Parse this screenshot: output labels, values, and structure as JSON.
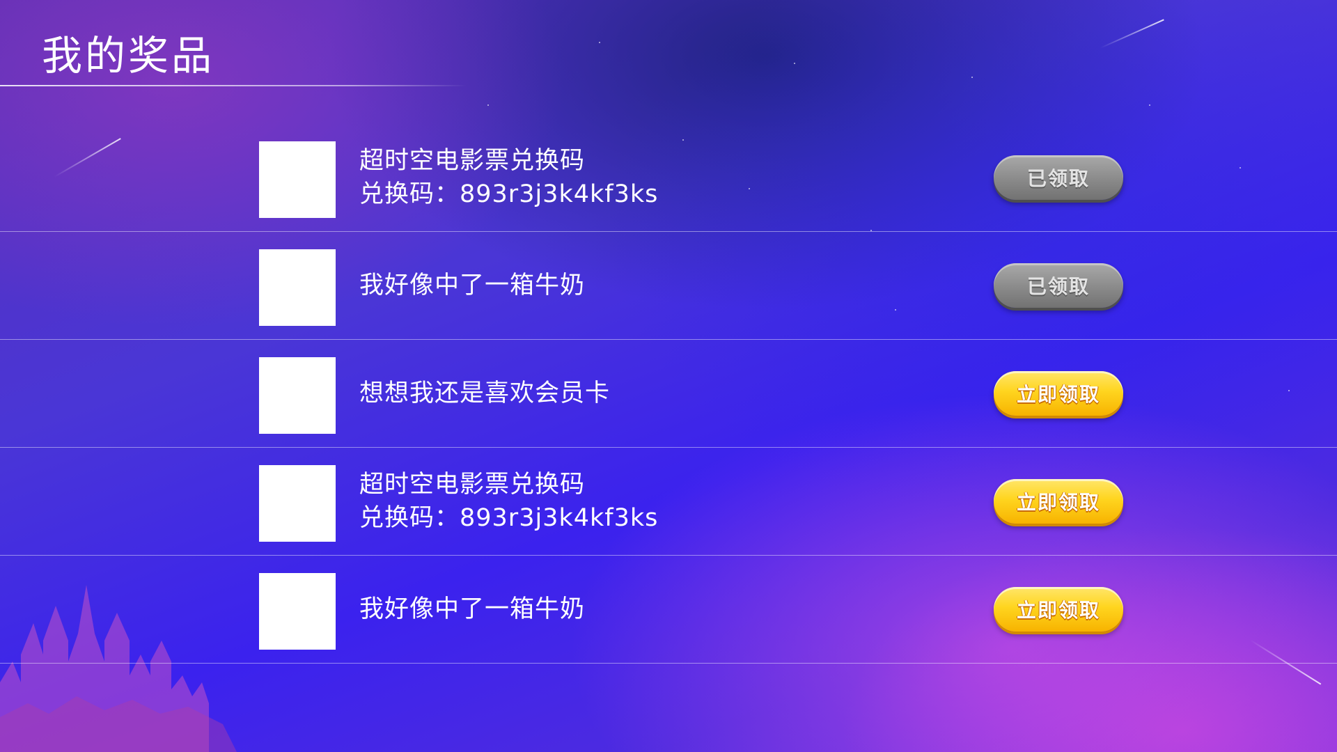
{
  "header": {
    "title": "我的奖品"
  },
  "prizes": [
    {
      "name": "超时空电影票兑换码",
      "code": "兑换码：893r3j3k4kf3ks",
      "button_label": "已领取",
      "status": "claimed"
    },
    {
      "name": "我好像中了一箱牛奶",
      "code": "",
      "button_label": "已领取",
      "status": "claimed"
    },
    {
      "name": "想想我还是喜欢会员卡",
      "code": "",
      "button_label": "立即领取",
      "status": "available"
    },
    {
      "name": "超时空电影票兑换码",
      "code": "兑换码：893r3j3k4kf3ks",
      "button_label": "立即领取",
      "status": "available"
    },
    {
      "name": "我好像中了一箱牛奶",
      "code": "",
      "button_label": "立即领取",
      "status": "available"
    }
  ],
  "colors": {
    "claimed_button": "#8a8a8a",
    "available_button": "#ffd51f",
    "background_primary": "#3b22ee",
    "background_accent": "#e756e6"
  }
}
